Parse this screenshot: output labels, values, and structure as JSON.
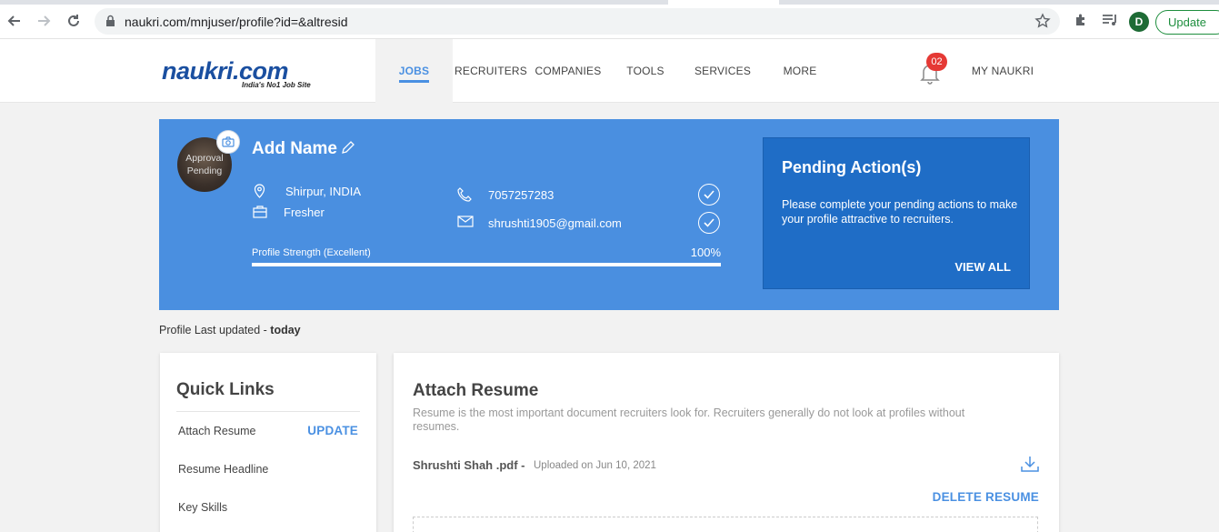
{
  "browser": {
    "url": "naukri.com/mnjuser/profile?id=&altresid",
    "profile_initial": "D",
    "update_label": "Update"
  },
  "header": {
    "logo_text": "naukri.com",
    "logo_tagline": "India's No1 Job Site",
    "nav": [
      "JOBS",
      "RECRUITERS",
      "COMPANIES",
      "TOOLS",
      "SERVICES",
      "MORE"
    ],
    "notification_count": "02",
    "my_naukri": "MY NAUKRI"
  },
  "profile": {
    "avatar_status": "Approval Pending",
    "name": "Add Name",
    "location": "Shirpur, INDIA",
    "experience": "Fresher",
    "phone": "7057257283",
    "email": "shrushti1905@gmail.com",
    "strength_label": "Profile Strength (Excellent)",
    "strength_pct": "100%",
    "strength_value": 1.0
  },
  "pending": {
    "title": "Pending Action(s)",
    "text": "Please complete your pending actions to make your profile attractive to recruiters.",
    "view_all": "VIEW ALL"
  },
  "last_updated": {
    "prefix": "Profile Last updated - ",
    "value": "today"
  },
  "quick_links": {
    "title": "Quick Links",
    "items": [
      "Attach Resume",
      "Resume Headline",
      "Key Skills"
    ],
    "update": "UPDATE"
  },
  "resume": {
    "title": "Attach Resume",
    "description": "Resume is the most important document recruiters look for. Recruiters generally do not look at profiles without resumes.",
    "file_name": "Shrushti Shah .pdf -",
    "uploaded": "Uploaded on Jun 10, 2021",
    "delete": "DELETE RESUME"
  },
  "colors": {
    "brand_blue": "#4a8fe0",
    "pending_blue": "#1f6dc6",
    "link_blue": "#4a90e2",
    "badge_red": "#e53935"
  }
}
